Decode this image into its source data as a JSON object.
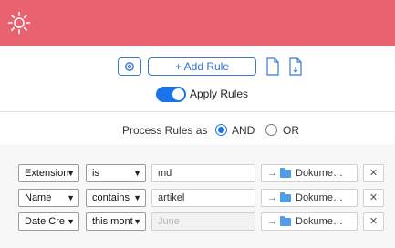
{
  "header": {
    "icon": "sun-icon",
    "color": "#e8636f"
  },
  "toolbar": {
    "settings_icon": "gear-icon",
    "add_rule_label": "+ Add Rule",
    "import_icon": "file-import-icon",
    "export_icon": "file-export-icon"
  },
  "apply": {
    "label": "Apply Rules",
    "enabled": true
  },
  "process": {
    "prefix": "Process Rules as",
    "options": [
      "AND",
      "OR"
    ],
    "selected": "AND"
  },
  "rules": [
    {
      "field": "Extension",
      "operator": "is",
      "value": "md",
      "placeholder": "",
      "target": "Dokume…"
    },
    {
      "field": "Name",
      "operator": "contains",
      "value": "artikel",
      "placeholder": "",
      "target": "Dokume…"
    },
    {
      "field": "Date Cre",
      "operator": "this mont",
      "value": "",
      "placeholder": "June",
      "target": "Dokume…"
    }
  ],
  "colors": {
    "accent": "#1a73e8",
    "header": "#e8636f",
    "folder": "#4f9de8"
  }
}
